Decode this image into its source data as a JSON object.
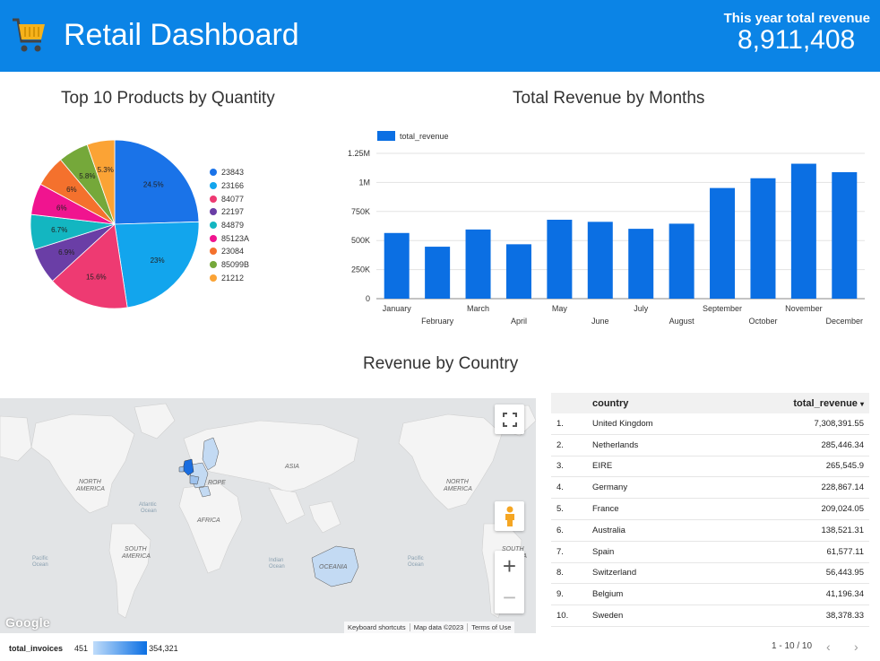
{
  "header": {
    "title": "Retail Dashboard",
    "revenue_label": "This year total revenue",
    "revenue_value": "8,911,408",
    "bg_color": "#0b84e6"
  },
  "pie": {
    "title": "Top 10 Products by Quantity",
    "slices": [
      {
        "label": "23843",
        "pct": 24.5,
        "text": "24.5%",
        "color": "#1a73e8"
      },
      {
        "label": "23166",
        "pct": 23.0,
        "text": "23%",
        "color": "#12a5ed"
      },
      {
        "label": "84077",
        "pct": 15.6,
        "text": "15.6%",
        "color": "#ee3a72"
      },
      {
        "label": "22197",
        "pct": 6.9,
        "text": "6.9%",
        "color": "#6a3ea6"
      },
      {
        "label": "84879",
        "pct": 6.7,
        "text": "6.7%",
        "color": "#13b6c1"
      },
      {
        "label": "85123A",
        "pct": 6.0,
        "text": "6%",
        "color": "#f0148f"
      },
      {
        "label": "23084",
        "pct": 6.0,
        "text": "6%",
        "color": "#f4712d"
      },
      {
        "label": "85099B",
        "pct": 5.8,
        "text": "5.8%",
        "color": "#75a83a"
      },
      {
        "label": "21212",
        "pct": 5.3,
        "text": "5.3%",
        "color": "#fba335"
      }
    ]
  },
  "chart_data": {
    "type": "bar",
    "title": "Total Revenue by Months",
    "series": [
      {
        "name": "total_revenue",
        "values": [
          565000,
          447000,
          595000,
          468000,
          679000,
          661000,
          601000,
          645000,
          952000,
          1036000,
          1161000,
          1088000
        ]
      }
    ],
    "categories": [
      "January",
      "February",
      "March",
      "April",
      "May",
      "June",
      "July",
      "August",
      "September",
      "October",
      "November",
      "December"
    ],
    "ylim": [
      0,
      1250000
    ],
    "yticks": [
      "0",
      "250K",
      "500K",
      "750K",
      "1M",
      "1.25M"
    ],
    "grid": true,
    "legend": "top-left",
    "color": "#0b6fe3"
  },
  "map": {
    "title": "Revenue by Country",
    "labels": {
      "north_america": "NORTH\nAMERICA",
      "south_america": "SOUTH\nAMERICA",
      "europe": "ROPE",
      "asia": "ASIA",
      "africa": "AFRICA",
      "oceania": "OCEANIA",
      "atlantic": "Atlantic\nOcean",
      "indian": "Indian\nOcean",
      "pacific": "Pacific\nOcean"
    },
    "google": "Google",
    "footer": [
      "Keyboard shortcuts",
      "Map data ©2023",
      "Terms of Use"
    ],
    "scale_label": "total_invoices",
    "scale_min": "451",
    "scale_max": "354,321"
  },
  "table": {
    "col_country": "country",
    "col_revenue": "total_revenue",
    "rows": [
      {
        "n": "1.",
        "country": "United Kingdom",
        "rev": "7,308,391.55"
      },
      {
        "n": "2.",
        "country": "Netherlands",
        "rev": "285,446.34"
      },
      {
        "n": "3.",
        "country": "EIRE",
        "rev": "265,545.9"
      },
      {
        "n": "4.",
        "country": "Germany",
        "rev": "228,867.14"
      },
      {
        "n": "5.",
        "country": "France",
        "rev": "209,024.05"
      },
      {
        "n": "6.",
        "country": "Australia",
        "rev": "138,521.31"
      },
      {
        "n": "7.",
        "country": "Spain",
        "rev": "61,577.11"
      },
      {
        "n": "8.",
        "country": "Switzerland",
        "rev": "56,443.95"
      },
      {
        "n": "9.",
        "country": "Belgium",
        "rev": "41,196.34"
      },
      {
        "n": "10.",
        "country": "Sweden",
        "rev": "38,378.33"
      }
    ],
    "pager": "1 - 10 / 10"
  }
}
